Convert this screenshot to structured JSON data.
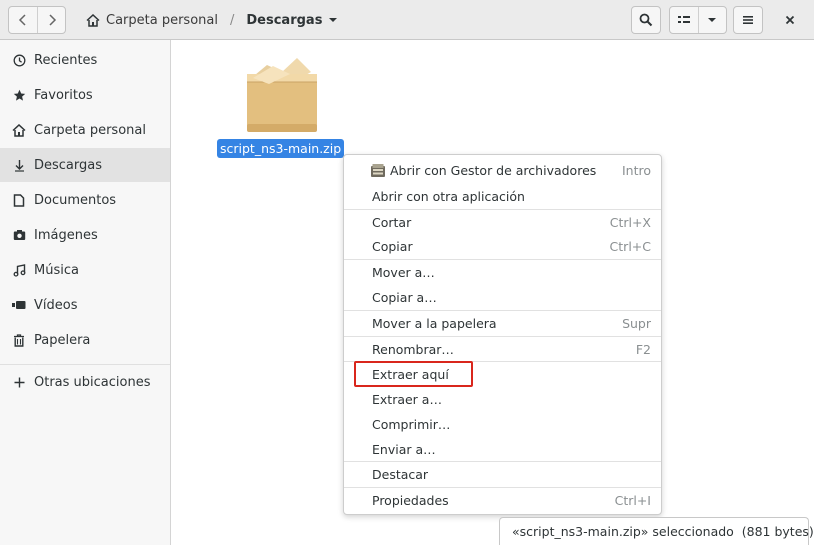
{
  "header": {
    "path": [
      {
        "label": "Carpeta personal",
        "icon": "home-icon"
      },
      {
        "label": "Descargas",
        "icon": "chevron-down-icon"
      }
    ]
  },
  "sidebar": {
    "items": [
      {
        "label": "Recientes",
        "icon": "clock-icon"
      },
      {
        "label": "Favoritos",
        "icon": "star-icon"
      },
      {
        "label": "Carpeta personal",
        "icon": "home-icon"
      },
      {
        "label": "Descargas",
        "icon": "download-icon",
        "active": true
      },
      {
        "label": "Documentos",
        "icon": "document-icon"
      },
      {
        "label": "Imágenes",
        "icon": "camera-icon"
      },
      {
        "label": "Música",
        "icon": "music-icon"
      },
      {
        "label": "Vídeos",
        "icon": "video-icon"
      },
      {
        "label": "Papelera",
        "icon": "trash-icon"
      },
      {
        "label": "Otras ubicaciones",
        "icon": "plus-icon"
      }
    ]
  },
  "file": {
    "name": "script_ns3-main.zip",
    "icon": "archive-icon"
  },
  "context_menu": {
    "items": [
      {
        "label": "Abrir con Gestor de archivadores",
        "accel": "Intro"
      },
      {
        "label": "Abrir con otra aplicación",
        "accel": ""
      },
      {
        "label": "Cortar",
        "accel": "Ctrl+X"
      },
      {
        "label": "Copiar",
        "accel": "Ctrl+C"
      },
      {
        "label": "Mover a…",
        "accel": ""
      },
      {
        "label": "Copiar a…",
        "accel": ""
      },
      {
        "label": "Mover a la papelera",
        "accel": "Supr"
      },
      {
        "label": "Renombrar…",
        "accel": "F2"
      },
      {
        "label": "Extraer aquí",
        "accel": ""
      },
      {
        "label": "Extraer a…",
        "accel": ""
      },
      {
        "label": "Comprimir…",
        "accel": ""
      },
      {
        "label": "Enviar a…",
        "accel": ""
      },
      {
        "label": "Destacar",
        "accel": ""
      },
      {
        "label": "Propiedades",
        "accel": "Ctrl+I"
      }
    ],
    "highlighted": "Extraer aquí",
    "highlight_color": "#d9261c"
  },
  "status": {
    "text": "«script_ns3-main.zip» seleccionado  (881 bytes)"
  },
  "colors": {
    "selection": "#3584e4",
    "header_bg": "#ebebeb",
    "sidebar_bg": "#f7f7f7"
  }
}
